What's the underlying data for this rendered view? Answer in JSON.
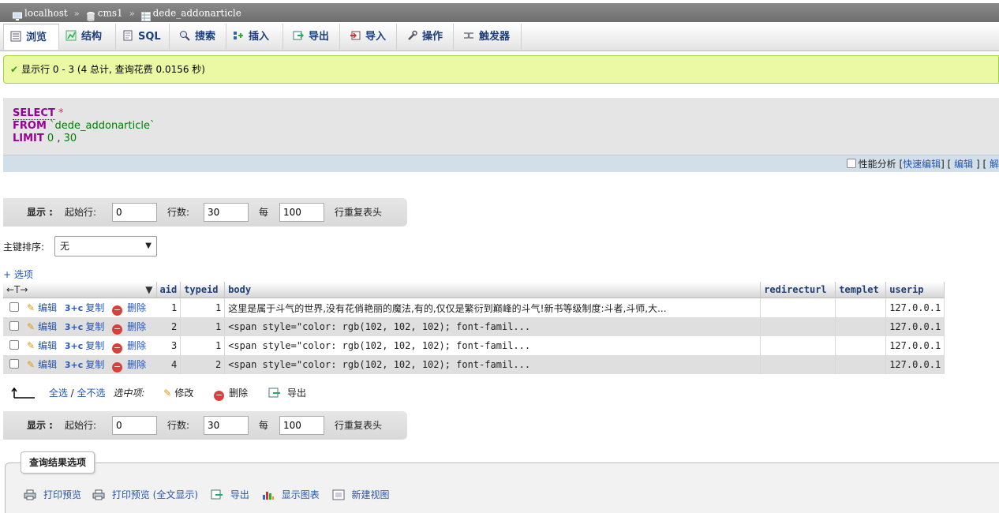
{
  "breadcrumb": {
    "server": "localhost",
    "database": "cms1",
    "table": "dede_addonarticle",
    "separator": "»"
  },
  "tabs": [
    {
      "label": "浏览",
      "icon": "browse-icon",
      "active": true
    },
    {
      "label": "结构",
      "icon": "structure-icon"
    },
    {
      "label": "SQL",
      "icon": "sql-icon"
    },
    {
      "label": "搜索",
      "icon": "search-icon"
    },
    {
      "label": "插入",
      "icon": "insert-icon"
    },
    {
      "label": "导出",
      "icon": "export-icon"
    },
    {
      "label": "导入",
      "icon": "import-icon"
    },
    {
      "label": "操作",
      "icon": "wrench-icon"
    },
    {
      "label": "触发器",
      "icon": "triggers-icon"
    }
  ],
  "success": {
    "message": "显示行 0 - 3 (4 总计, 查询花费 0.0156 秒)"
  },
  "sql": {
    "select_kw": "SELECT",
    "star": "*",
    "from_kw": "FROM",
    "table": "`dede_addonarticle`",
    "limit_kw": "LIMIT",
    "limit_start": "0",
    "comma": ",",
    "limit_count": "30"
  },
  "sql_bar": {
    "profiling": "性能分析",
    "inline_edit": "快速编辑",
    "edit": "编辑",
    "explain": "解"
  },
  "nav": {
    "show_label": "显示 :",
    "start_label": "起始行:",
    "start_value": "0",
    "rows_label": "行数:",
    "rows_value": "30",
    "every_label": "每",
    "every_value": "100",
    "repeat_label": "行重复表头"
  },
  "sort": {
    "label": "主键排序:",
    "selected": "无"
  },
  "options_link": "+ 选项",
  "table": {
    "columns": [
      "aid",
      "typeid",
      "body",
      "redirecturl",
      "templet",
      "userip"
    ],
    "actions": {
      "edit": "编辑",
      "copy": "复制",
      "delete": "删除"
    },
    "rows": [
      {
        "aid": "1",
        "typeid": "1",
        "body": "这里是属于斗气的世界,没有花俏艳丽的魔法,有的,仅仅是繁衍到巅峰的斗气!新书等级制度:斗者,斗师,大...",
        "redirecturl": "",
        "templet": "",
        "userip": "127.0.0.1"
      },
      {
        "aid": "2",
        "typeid": "1",
        "body": "<span style=\"color: rgb(102, 102, 102); font-famil...",
        "redirecturl": "",
        "templet": "",
        "userip": "127.0.0.1"
      },
      {
        "aid": "3",
        "typeid": "1",
        "body": "<span style=\"color: rgb(102, 102, 102); font-famil...",
        "redirecturl": "",
        "templet": "",
        "userip": "127.0.0.1"
      },
      {
        "aid": "4",
        "typeid": "2",
        "body": "<span style=\"color: rgb(102, 102, 102); font-famil...",
        "redirecturl": "",
        "templet": "",
        "userip": "127.0.0.1"
      }
    ]
  },
  "bulk": {
    "check_all": "全选",
    "slash": "/",
    "uncheck_all": "全不选",
    "with_selected": "选中项:",
    "change": "修改",
    "delete": "删除",
    "export": "导出"
  },
  "result_ops": {
    "legend": "查询结果选项",
    "print": "打印预览",
    "print_full": "打印预览 (全文显示)",
    "export": "导出",
    "chart": "显示图表",
    "create_view": "新建视图"
  }
}
